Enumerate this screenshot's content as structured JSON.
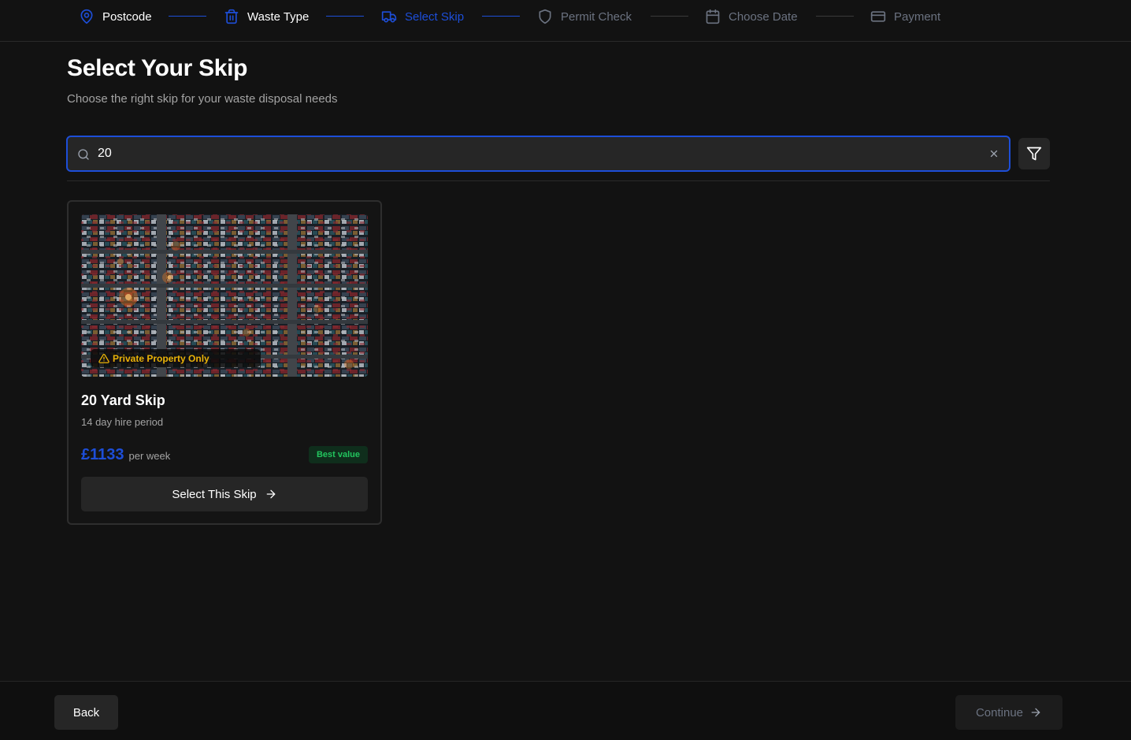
{
  "stepper": {
    "steps": [
      {
        "label": "Postcode",
        "icon": "map-pin-icon",
        "state": "done"
      },
      {
        "label": "Waste Type",
        "icon": "trash-icon",
        "state": "done"
      },
      {
        "label": "Select Skip",
        "icon": "truck-icon",
        "state": "active"
      },
      {
        "label": "Permit Check",
        "icon": "shield-icon",
        "state": "pending"
      },
      {
        "label": "Choose Date",
        "icon": "calendar-icon",
        "state": "pending"
      },
      {
        "label": "Payment",
        "icon": "credit-card-icon",
        "state": "pending"
      }
    ]
  },
  "header": {
    "title": "Select Your Skip",
    "subtitle": "Choose the right skip for your waste disposal needs"
  },
  "search": {
    "value": "20"
  },
  "skips": [
    {
      "warning": "Private Property Only",
      "title": "20 Yard Skip",
      "hire_period": "14 day hire period",
      "price": "£1133",
      "price_unit": "per week",
      "badge": "Best value",
      "select_label": "Select This Skip"
    }
  ],
  "footer": {
    "back_label": "Back",
    "continue_label": "Continue"
  },
  "colors": {
    "accent": "#1d4ed8",
    "background": "#121212",
    "warning": "#eab308",
    "success": "#22c55e"
  }
}
